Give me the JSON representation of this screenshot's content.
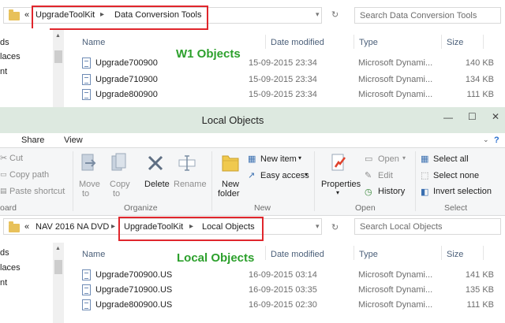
{
  "top_window": {
    "address": {
      "crumbs": [
        "«",
        "UpgradeToolKit",
        "Data Conversion Tools"
      ],
      "search_placeholder": "Search Data Conversion Tools"
    },
    "nav_items": [
      "ds",
      "laces",
      "nt"
    ],
    "columns": [
      "Name",
      "Date modified",
      "Type",
      "Size"
    ],
    "files": [
      {
        "name": "Upgrade700900",
        "date": "15-09-2015 23:34",
        "type": "Microsoft Dynami...",
        "size": "140 KB"
      },
      {
        "name": "Upgrade710900",
        "date": "15-09-2015 23:34",
        "type": "Microsoft Dynami...",
        "size": "134 KB"
      },
      {
        "name": "Upgrade800900",
        "date": "15-09-2015 23:34",
        "type": "Microsoft Dynami...",
        "size": "111 KB"
      }
    ],
    "annotation": "W1 Objects"
  },
  "bottom_window": {
    "title": "Local Objects",
    "tabs": [
      "Share",
      "View"
    ],
    "ribbon": {
      "clipboard": {
        "cut": "Cut",
        "copy_path": "Copy path",
        "paste_shortcut": "Paste shortcut",
        "group": "oard"
      },
      "organize": {
        "move_to": "Move",
        "move_to2": "to",
        "copy_to": "Copy",
        "copy_to2": "to",
        "delete": "Delete",
        "rename": "Rename",
        "group": "Organize"
      },
      "new": {
        "new_folder": "New",
        "new_folder2": "folder",
        "new_item": "New item",
        "easy_access": "Easy access",
        "group": "New"
      },
      "open": {
        "properties": "Properties",
        "open": "Open",
        "edit": "Edit",
        "history": "History",
        "group": "Open"
      },
      "select": {
        "select_all": "Select all",
        "select_none": "Select none",
        "invert": "Invert selection",
        "group": "Select"
      }
    },
    "address": {
      "crumbs": [
        "«",
        "NAV 2016 NA DVD",
        "UpgradeToolKit",
        "Local Objects"
      ],
      "search_placeholder": "Search Local Objects"
    },
    "nav_items": [
      "ds",
      "laces",
      "nt"
    ],
    "columns": [
      "Name",
      "Date modified",
      "Type",
      "Size"
    ],
    "files": [
      {
        "name": "Upgrade700900.US",
        "date": "16-09-2015 03:14",
        "type": "Microsoft Dynami...",
        "size": "141 KB"
      },
      {
        "name": "Upgrade710900.US",
        "date": "16-09-2015 03:35",
        "type": "Microsoft Dynami...",
        "size": "135 KB"
      },
      {
        "name": "Upgrade800900.US",
        "date": "16-09-2015 02:30",
        "type": "Microsoft Dynami...",
        "size": "111 KB"
      }
    ],
    "annotation": "Local Objects"
  },
  "colors": {
    "annotation_green": "#2ca02c",
    "highlight_red": "#e0262c",
    "titlebar": "#dde9e0"
  }
}
